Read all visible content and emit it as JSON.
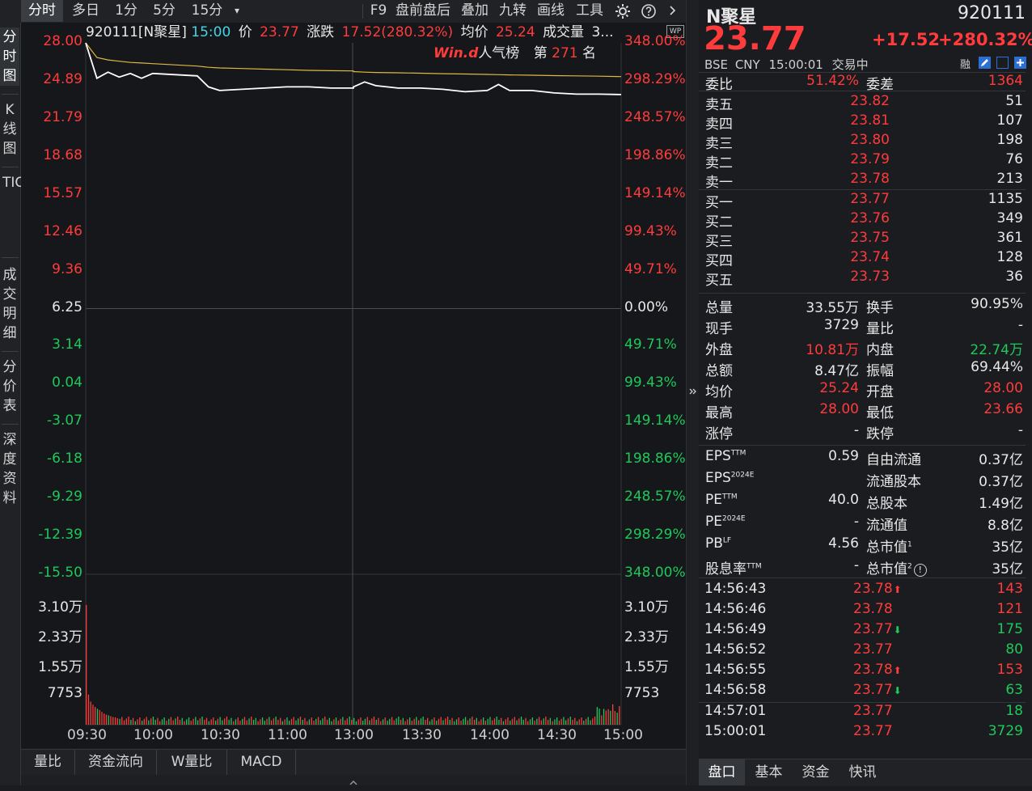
{
  "toolbar": {
    "tabs": [
      "分时",
      "多日",
      "1分",
      "5分",
      "15分"
    ],
    "dropdown": "▾",
    "items": [
      "F9",
      "盘前盘后",
      "叠加",
      "九转",
      "画线",
      "工具"
    ]
  },
  "left_tabs": [
    "分时图",
    "K线图",
    "TICK",
    "成交明细",
    "分价表",
    "深度资料"
  ],
  "info_bar": {
    "code_name": "920111[N聚星]",
    "time": "15:00",
    "price_label": "价",
    "price": "23.77",
    "change_label": "涨跌",
    "change": "17.52(280.32%)",
    "avg_label": "均价",
    "avg": "25.24",
    "vol_label": "成交量",
    "vol": "3..."
  },
  "wp_badge": "WP",
  "popularity": {
    "brand": "Win.d",
    "label": "人气榜",
    "rank_prefix": "第",
    "rank": "271",
    "rank_suffix": "名"
  },
  "price_axis_left": [
    "28.00",
    "24.89",
    "21.79",
    "18.68",
    "15.57",
    "12.46",
    "9.36",
    "6.25",
    "3.14",
    "0.04",
    "-3.07",
    "-6.18",
    "-9.29",
    "-12.39",
    "-15.50"
  ],
  "price_axis_right": [
    "348.00%",
    "298.29%",
    "248.57%",
    "198.86%",
    "149.14%",
    "99.43%",
    "49.71%",
    "0.00%",
    "49.71%",
    "99.43%",
    "149.14%",
    "198.86%",
    "248.57%",
    "298.29%",
    "348.00%"
  ],
  "volume_axis": [
    "3.10万",
    "2.33万",
    "1.55万",
    "7753"
  ],
  "volume_axis_right": [
    "3.10万",
    "2.33万",
    "1.55万",
    "7753"
  ],
  "time_axis": [
    "09:30",
    "10:00",
    "10:30",
    "11:00",
    "13:00",
    "13:30",
    "14:00",
    "14:30",
    "15:00"
  ],
  "chart_data": {
    "type": "line",
    "title": "",
    "x": [
      "09:30",
      "09:35",
      "09:40",
      "09:45",
      "09:50",
      "09:55",
      "10:00",
      "10:10",
      "10:20",
      "10:25",
      "10:30",
      "10:40",
      "10:50",
      "11:00",
      "11:10",
      "11:20",
      "11:30",
      "13:00",
      "13:05",
      "13:10",
      "13:20",
      "13:30",
      "13:40",
      "13:50",
      "14:00",
      "14:05",
      "14:10",
      "14:20",
      "14:30",
      "14:40",
      "14:50",
      "15:00"
    ],
    "series": [
      {
        "values": [
          28.0,
          25.1,
          25.6,
          25.2,
          25.5,
          25.1,
          25.5,
          25.4,
          25.3,
          24.4,
          24.1,
          24.2,
          24.3,
          24.4,
          24.4,
          24.3,
          24.3,
          24.4,
          24.8,
          24.5,
          24.3,
          24.3,
          24.2,
          24.0,
          24.1,
          24.6,
          24.1,
          24.1,
          23.9,
          23.8,
          23.8,
          23.77
        ]
      },
      {
        "values": [
          28.0,
          26.8,
          26.6,
          26.5,
          26.4,
          26.35,
          26.3,
          26.2,
          26.1,
          26.0,
          25.95,
          25.9,
          25.85,
          25.8,
          25.75,
          25.72,
          25.7,
          25.65,
          25.6,
          25.58,
          25.55,
          25.52,
          25.48,
          25.45,
          25.42,
          25.4,
          25.38,
          25.35,
          25.32,
          25.3,
          25.27,
          25.24
        ]
      }
    ],
    "ylim": [
      -15.5,
      28.0
    ],
    "volume_ylim": [
      0,
      31000
    ],
    "colors": {
      "price": "#ffffff",
      "avg": "#e0b840",
      "up": "#ff3b3b",
      "down": "#1ec85a"
    }
  },
  "indicator_tabs": [
    "量比",
    "资金流向",
    "W量比",
    "MACD"
  ],
  "quote": {
    "name": "N聚星",
    "code": "920111",
    "price": "23.77",
    "change": "+17.52",
    "change_pct": "+280.32%",
    "exchange": "BSE",
    "currency": "CNY",
    "time": "15:00:01",
    "status": "交易中",
    "rong": "融"
  },
  "order_ratio": {
    "label1": "委比",
    "v1": "51.42%",
    "label2": "委差",
    "v2": "1364"
  },
  "asks": [
    {
      "label": "卖五",
      "price": "23.82",
      "vol": "51"
    },
    {
      "label": "卖四",
      "price": "23.81",
      "vol": "107"
    },
    {
      "label": "卖三",
      "price": "23.80",
      "vol": "198"
    },
    {
      "label": "卖二",
      "price": "23.79",
      "vol": "76"
    },
    {
      "label": "卖一",
      "price": "23.78",
      "vol": "213"
    }
  ],
  "bids": [
    {
      "label": "买一",
      "price": "23.77",
      "vol": "1135"
    },
    {
      "label": "买二",
      "price": "23.76",
      "vol": "349"
    },
    {
      "label": "买三",
      "price": "23.75",
      "vol": "361"
    },
    {
      "label": "买四",
      "price": "23.74",
      "vol": "128"
    },
    {
      "label": "买五",
      "price": "23.73",
      "vol": "36"
    }
  ],
  "stats": [
    {
      "l1": "总量",
      "v1": "33.55万",
      "c1": "white",
      "l2": "换手",
      "v2": "90.95%",
      "c2": "white"
    },
    {
      "l1": "现手",
      "v1": "3729",
      "c1": "white",
      "l2": "量比",
      "v2": "-",
      "c2": "white"
    },
    {
      "l1": "外盘",
      "v1": "10.81万",
      "c1": "red",
      "l2": "内盘",
      "v2": "22.74万",
      "c2": "green"
    },
    {
      "l1": "总额",
      "v1": "8.47亿",
      "c1": "white",
      "l2": "振幅",
      "v2": "69.44%",
      "c2": "white"
    },
    {
      "l1": "均价",
      "v1": "25.24",
      "c1": "red",
      "l2": "开盘",
      "v2": "28.00",
      "c2": "red"
    },
    {
      "l1": "最高",
      "v1": "28.00",
      "c1": "red",
      "l2": "最低",
      "v2": "23.66",
      "c2": "red"
    },
    {
      "l1": "涨停",
      "v1": "-",
      "c1": "white",
      "l2": "跌停",
      "v2": "-",
      "c2": "white"
    }
  ],
  "fundamentals": [
    {
      "l1": "EPS",
      "s1": "TTM",
      "v1": "0.59",
      "l2": "自由流通",
      "s2": "",
      "v2": "0.37亿"
    },
    {
      "l1": "EPS",
      "s1": "2024E",
      "v1": "",
      "l2": "流通股本",
      "s2": "",
      "v2": "0.37亿"
    },
    {
      "l1": "PE",
      "s1": "TTM",
      "v1": "40.0",
      "l2": "总股本",
      "s2": "",
      "v2": "1.49亿"
    },
    {
      "l1": "PE",
      "s1": "2024E",
      "v1": "-",
      "l2": "流通值",
      "s2": "",
      "v2": "8.8亿"
    },
    {
      "l1": "PB",
      "s1": "LF",
      "v1": "4.56",
      "l2": "总市值",
      "s2": "1",
      "v2": "35亿"
    },
    {
      "l1": "股息率",
      "s1": "TTM",
      "v1": "-",
      "l2": "总市值",
      "s2": "2",
      "v2": "35亿"
    }
  ],
  "ticks": [
    {
      "time": "14:56:43",
      "price": "23.78",
      "arrow": "up",
      "vol": "143",
      "vc": "red"
    },
    {
      "time": "14:56:46",
      "price": "23.78",
      "arrow": "",
      "vol": "121",
      "vc": "red"
    },
    {
      "time": "14:56:49",
      "price": "23.77",
      "arrow": "down",
      "vol": "175",
      "vc": "green"
    },
    {
      "time": "14:56:52",
      "price": "23.77",
      "arrow": "",
      "vol": "80",
      "vc": "green"
    },
    {
      "time": "14:56:55",
      "price": "23.78",
      "arrow": "up",
      "vol": "153",
      "vc": "red"
    },
    {
      "time": "14:56:58",
      "price": "23.77",
      "arrow": "down",
      "vol": "63",
      "vc": "green"
    },
    {
      "time": "14:57:01",
      "price": "23.77",
      "arrow": "",
      "vol": "18",
      "vc": "green"
    },
    {
      "time": "15:00:01",
      "price": "23.77",
      "arrow": "",
      "vol": "3729",
      "vc": "green"
    }
  ],
  "right_tabs": [
    "盘口",
    "基本",
    "资金",
    "快讯"
  ]
}
